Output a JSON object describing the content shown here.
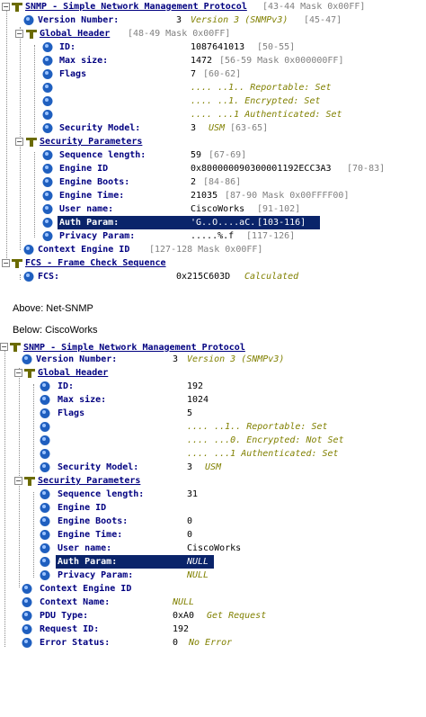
{
  "netsnmp": {
    "root": {
      "label": "SNMP - Simple Network Management Protocol",
      "extra": "[43-44 Mask 0x00FF]"
    },
    "version": {
      "label": "Version Number:",
      "value": "3",
      "desc": "Version 3 (SNMPv3)",
      "extra": "[45-47]"
    },
    "global_header": {
      "label": "Global Header",
      "extra": "[48-49 Mask 0x00FF]"
    },
    "id": {
      "label": "ID:",
      "value": "1087641013",
      "extra": "[50-55]"
    },
    "max_size": {
      "label": "Max size:",
      "value": "1472",
      "extra": "[56-59 Mask 0x000000FF]"
    },
    "flags": {
      "label": "Flags",
      "value": "7",
      "extra": "[60-62]"
    },
    "flag_bits": [
      ".... ..1.. Reportable: Set",
      ".... ..1. Encrypted: Set",
      ".... ...1 Authenticated: Set"
    ],
    "security_model": {
      "label": "Security Model:",
      "value": "3",
      "desc": "USM",
      "extra": "[63-65]"
    },
    "security_params": {
      "label": "Security Parameters"
    },
    "sequence_length": {
      "label": "Sequence length:",
      "value": "59",
      "extra": "[67-69]"
    },
    "engine_id": {
      "label": "Engine ID",
      "value": "0x800000090300001192ECC3A3",
      "extra": "[70-83]"
    },
    "engine_boots": {
      "label": "Engine Boots:",
      "value": "2",
      "extra": "[84-86]"
    },
    "engine_time": {
      "label": "Engine Time:",
      "value": "21035",
      "extra": "[87-90 Mask 0x00FFFF00]"
    },
    "user_name": {
      "label": "User name:",
      "value": "CiscoWorks",
      "extra": "[91-102]"
    },
    "auth_param": {
      "label": "Auth Param:",
      "value": "'G..O....aC.",
      "extra": "[103-116]"
    },
    "privacy_param": {
      "label": "Privacy Param:",
      "value": ".....%.f",
      "extra": "[117-126]"
    },
    "context_engine_id": {
      "label": "Context Engine ID",
      "extra": "[127-128 Mask 0x00FF]"
    },
    "fcs_section": {
      "label": "FCS - Frame Check Sequence"
    },
    "fcs": {
      "label": "FCS:",
      "value": "0x215C603D",
      "desc": "Calculated"
    }
  },
  "captions": {
    "above": "Above: Net-SNMP",
    "below": "Below: CiscoWorks"
  },
  "ciscoworks": {
    "root": {
      "label": "SNMP - Simple Network Management Protocol"
    },
    "version": {
      "label": "Version Number:",
      "value": "3",
      "desc": "Version 3 (SNMPv3)"
    },
    "global_header": {
      "label": "Global Header"
    },
    "id": {
      "label": "ID:",
      "value": "192"
    },
    "max_size": {
      "label": "Max size:",
      "value": "1024"
    },
    "flags": {
      "label": "Flags",
      "value": "5"
    },
    "flag_bits": [
      ".... ..1.. Reportable: Set",
      ".... ...0. Encrypted: Not Set",
      ".... ...1 Authenticated: Set"
    ],
    "security_model": {
      "label": "Security Model:",
      "value": "3",
      "desc": "USM"
    },
    "security_params": {
      "label": "Security Parameters"
    },
    "sequence_length": {
      "label": "Sequence length:",
      "value": "31"
    },
    "engine_id": {
      "label": "Engine ID"
    },
    "engine_boots": {
      "label": "Engine Boots:",
      "value": "0"
    },
    "engine_time": {
      "label": "Engine Time:",
      "value": "0"
    },
    "user_name": {
      "label": "User name:",
      "value": "CiscoWorks"
    },
    "auth_param": {
      "label": "Auth Param:",
      "value": "NULL"
    },
    "privacy_param": {
      "label": "Privacy Param:",
      "value": "NULL"
    },
    "context_engine_id": {
      "label": "Context Engine ID"
    },
    "context_name": {
      "label": "Context Name:",
      "value": "NULL"
    },
    "pdu_type": {
      "label": "PDU Type:",
      "value": "0xA0",
      "desc": "Get Request"
    },
    "request_id": {
      "label": "Request ID:",
      "value": "192"
    },
    "error_status": {
      "label": "Error Status:",
      "value": "0",
      "desc": "No Error"
    }
  },
  "colors": {
    "label": "#000080",
    "description": "#808000",
    "offset_info": "#808080",
    "selection": "#0a246a",
    "icon_blue": "#1f5fbf"
  }
}
